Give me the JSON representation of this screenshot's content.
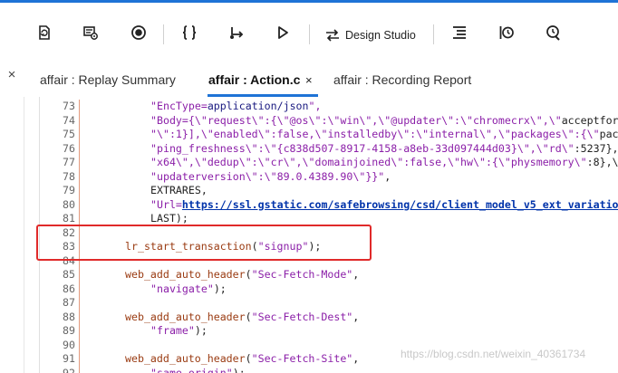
{
  "toolbar": {
    "design_studio_label": "Design Studio"
  },
  "tabs": [
    {
      "label": "affair : Replay Summary",
      "active": false
    },
    {
      "label": "affair : Action.c",
      "active": true,
      "close": "×"
    },
    {
      "label": "affair : Recording Report",
      "active": false
    }
  ],
  "left_close": "×",
  "editor": {
    "lines": [
      {
        "num": "73",
        "code": "\"EncType=application/json\","
      },
      {
        "num": "74",
        "code": "\"Body={\\\"request\\\":{\\\"@os\\\":\\\"win\\\",\\\"@updater\\\":\\\"chromecrx\\\",\\\"acceptfor"
      },
      {
        "num": "75",
        "code": "\"\\\":1}],\\\"enabled\\\":false,\\\"installedby\\\":\\\"internal\\\",\\\"packages\\\":{\\\"pac"
      },
      {
        "num": "76",
        "code": "\"ping_freshness\\\":\\\"{c838d507-8917-4158-a8eb-33d097444d03}\\\",\\\"rd\\\":5237},"
      },
      {
        "num": "77",
        "code": "\"x64\\\",\\\"dedup\\\":\\\"cr\\\",\\\"domainjoined\\\":false,\\\"hw\\\":{\\\"physmemory\\\":8},\\"
      },
      {
        "num": "78",
        "code": "\"updaterversion\\\":\\\"89.0.4389.90\\\"}}\","
      },
      {
        "num": "79",
        "code": "EXTRARES,"
      },
      {
        "num": "80",
        "code": "\"Url=https://ssl.gstatic.com/safebrowsing/csd/client_model_v5_ext_variatio"
      },
      {
        "num": "81",
        "code": "LAST);"
      },
      {
        "num": "82",
        "code": ""
      },
      {
        "num": "83",
        "code": "lr_start_transaction(\"signup\");"
      },
      {
        "num": "84",
        "code": ""
      },
      {
        "num": "85",
        "code": "web_add_auto_header(\"Sec-Fetch-Mode\","
      },
      {
        "num": "86",
        "code": "\"navigate\");"
      },
      {
        "num": "87",
        "code": ""
      },
      {
        "num": "88",
        "code": "web_add_auto_header(\"Sec-Fetch-Dest\","
      },
      {
        "num": "89",
        "code": "\"frame\");"
      },
      {
        "num": "90",
        "code": ""
      },
      {
        "num": "91",
        "code": "web_add_auto_header(\"Sec-Fetch-Site\","
      },
      {
        "num": "92",
        "code": "\"same-origin\");"
      }
    ]
  },
  "watermark": "https://blog.csdn.net/weixin_40361734",
  "colors": {
    "accent": "#1e73d6",
    "highlight_box": "#e02a2a",
    "function": "#9a3b12",
    "string": "#8b1fa8",
    "url": "#0033aa"
  }
}
